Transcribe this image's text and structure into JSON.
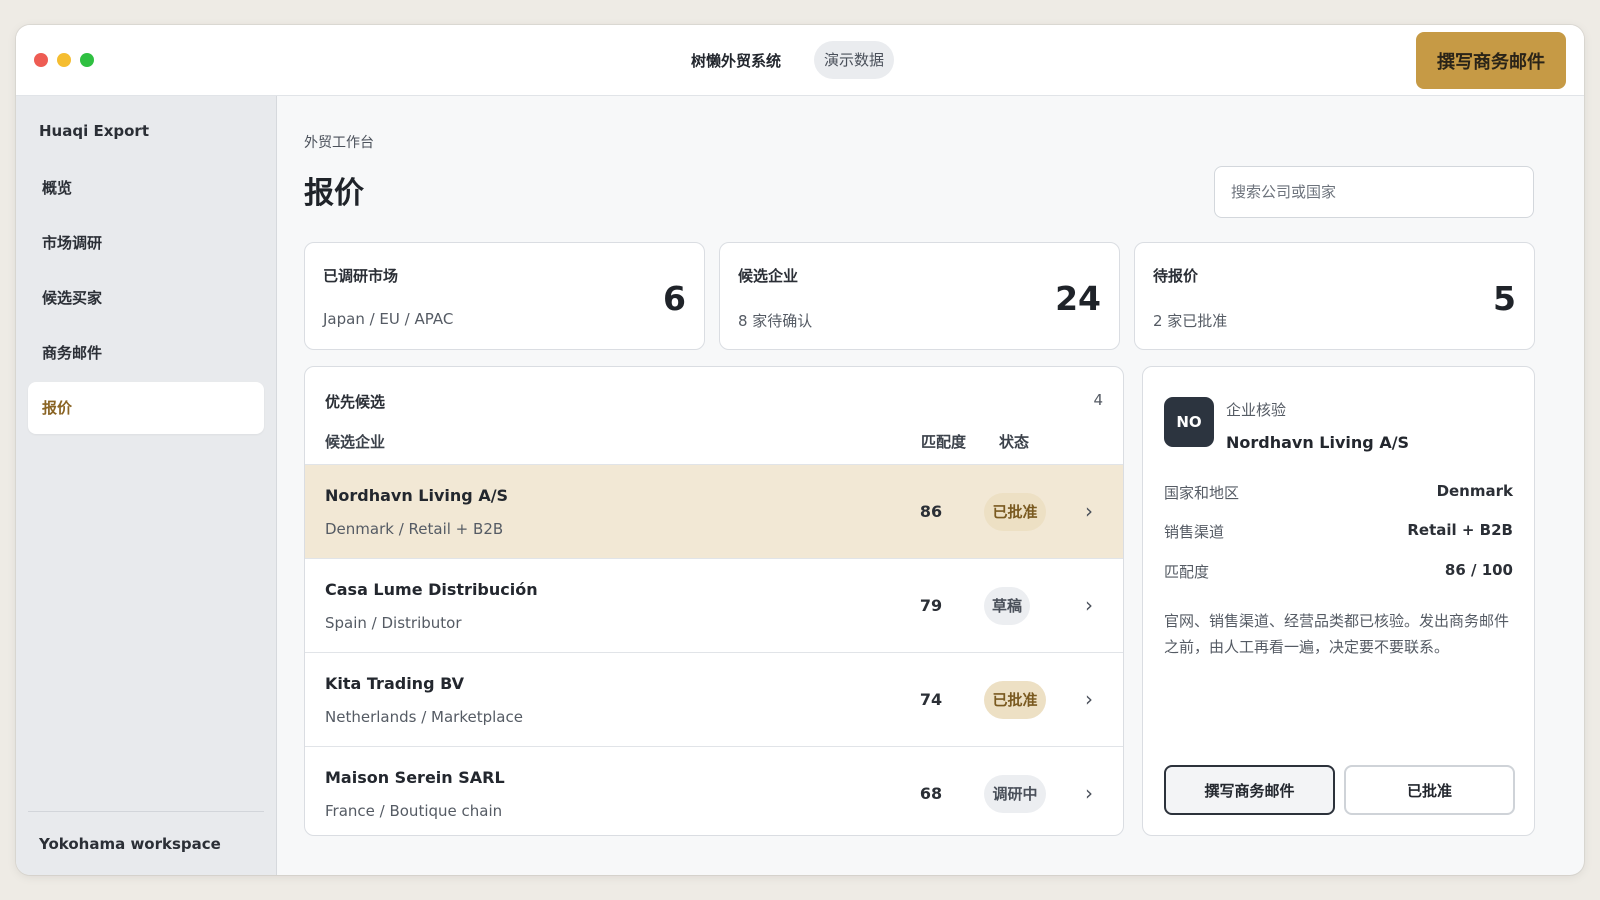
{
  "app": {
    "title": "树懒外贸系统",
    "demo_badge": "演示数据",
    "compose_button": "撰写商务邮件"
  },
  "sidebar": {
    "brand": "Huaqi Export",
    "items": [
      {
        "label": "概览"
      },
      {
        "label": "市场调研"
      },
      {
        "label": "候选买家"
      },
      {
        "label": "商务邮件"
      },
      {
        "label": "报价"
      }
    ],
    "active_index": 4,
    "workspace": "Yokohama workspace"
  },
  "main": {
    "kicker": "外贸工作台",
    "title": "报价",
    "search_placeholder": "搜索公司或国家"
  },
  "stats": [
    {
      "label": "已调研市场",
      "sub": "Japan / EU / APAC",
      "value": "6"
    },
    {
      "label": "候选企业",
      "sub": "8 家待确认",
      "value": "24"
    },
    {
      "label": "待报价",
      "sub": "2 家已批准",
      "value": "5"
    }
  ],
  "candidates": {
    "title": "优先候选",
    "count": "4",
    "columns": {
      "company": "候选企业",
      "score": "匹配度",
      "status": "状态"
    },
    "rows": [
      {
        "name": "Nordhavn Living A/S",
        "sub": "Denmark / Retail + B2B",
        "score": "86",
        "status": "已批准",
        "status_kind": "approved",
        "selected": true
      },
      {
        "name": "Casa Lume Distribución",
        "sub": "Spain / Distributor",
        "score": "79",
        "status": "草稿",
        "status_kind": "draft",
        "selected": false
      },
      {
        "name": "Kita Trading BV",
        "sub": "Netherlands / Marketplace",
        "score": "74",
        "status": "已批准",
        "status_kind": "approved",
        "selected": false
      },
      {
        "name": "Maison Serein SARL",
        "sub": "France / Boutique chain",
        "score": "68",
        "status": "调研中",
        "status_kind": "research",
        "selected": false
      }
    ],
    "chevron": "›"
  },
  "detail": {
    "avatar": "NO",
    "kicker": "企业核验",
    "name": "Nordhavn Living A/S",
    "fields": [
      {
        "key": "国家和地区",
        "value": "Denmark"
      },
      {
        "key": "销售渠道",
        "value": "Retail + B2B"
      },
      {
        "key": "匹配度",
        "value": "86 / 100"
      }
    ],
    "note": "官网、销售渠道、经营品类都已核验。发出商务邮件之前，由人工再看一遍，决定要不要联系。",
    "primary_button": "撰写商务邮件",
    "secondary_button": "已批准"
  },
  "colors": {
    "accent": "#c69a45",
    "selected_row": "#f2e8d5",
    "approved_badge": "#ede0c4",
    "avatar_bg": "#2c343f"
  }
}
